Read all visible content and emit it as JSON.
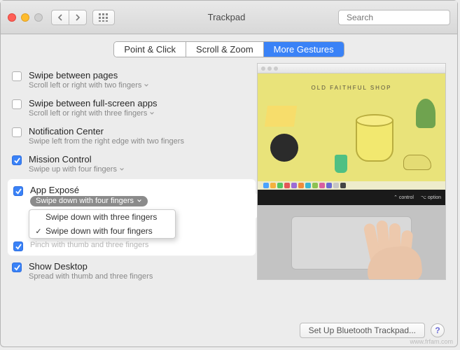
{
  "window": {
    "title": "Trackpad"
  },
  "toolbar": {
    "search_placeholder": "Search"
  },
  "tabs": [
    {
      "label": "Point & Click",
      "active": false
    },
    {
      "label": "Scroll & Zoom",
      "active": false
    },
    {
      "label": "More Gestures",
      "active": true
    }
  ],
  "options": [
    {
      "id": "swipe-pages",
      "checked": false,
      "title": "Swipe between pages",
      "subtitle": "Scroll left or right with two fingers",
      "has_menu": true
    },
    {
      "id": "swipe-apps",
      "checked": false,
      "title": "Swipe between full-screen apps",
      "subtitle": "Scroll left or right with three fingers",
      "has_menu": true
    },
    {
      "id": "notification-center",
      "checked": false,
      "title": "Notification Center",
      "subtitle": "Swipe left from the right edge with two fingers",
      "has_menu": false
    },
    {
      "id": "mission-control",
      "checked": true,
      "title": "Mission Control",
      "subtitle": "Swipe up with four fingers",
      "has_menu": true
    }
  ],
  "app_expose": {
    "checked": true,
    "title": "App Exposé",
    "selected": "Swipe down with four fingers",
    "menu": [
      {
        "label": "Swipe down with three fingers",
        "checked": false
      },
      {
        "label": "Swipe down with four fingers",
        "checked": true
      }
    ],
    "covered_row_checked": true,
    "covered_text": "Pinch with thumb and three fingers"
  },
  "show_desktop": {
    "checked": true,
    "title": "Show Desktop",
    "subtitle": "Spread with thumb and three fingers"
  },
  "preview": {
    "shop_label": "OLD FAITHFUL SHOP",
    "touchbar_keys": [
      "⌃ control",
      "⌥ option"
    ]
  },
  "footer": {
    "bluetooth_button": "Set Up Bluetooth Trackpad...",
    "help": "?"
  },
  "watermark": "www.frfam.com",
  "colors": {
    "accent": "#3a82f7"
  }
}
